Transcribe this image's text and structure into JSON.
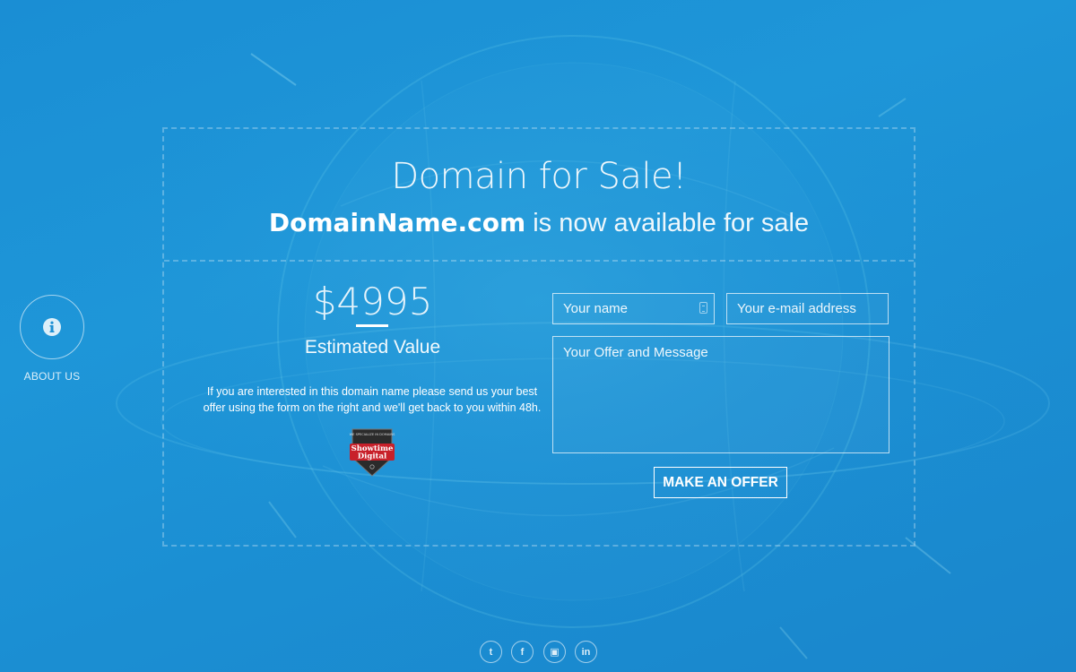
{
  "page": {
    "title": "Domain for Sale!",
    "domain": "DomainName.com",
    "subtitle_rest": " is now available for sale"
  },
  "offer": {
    "price": "$4995",
    "price_label": "Estimated Value",
    "description": "If you are interested in this domain name please send us your best offer using the form on the right and we'll get back to you within 48h.",
    "badge": {
      "top_text": "WE SPECIALIZE IN DOMAINS",
      "brand_line1": "Showtime",
      "brand_line2": "Digital"
    }
  },
  "form": {
    "name_placeholder": "Your name",
    "email_placeholder": "Your e-mail address",
    "message_placeholder": "Your Offer and Message",
    "submit_label": "MAKE AN OFFER"
  },
  "side_nav": {
    "about_label": "ABOUT US",
    "about_icon": "info-icon"
  },
  "social": [
    {
      "name": "twitter",
      "glyph": "t",
      "icon": "twitter-icon"
    },
    {
      "name": "facebook",
      "glyph": "f",
      "icon": "facebook-icon"
    },
    {
      "name": "youtube",
      "glyph": "▣",
      "icon": "youtube-icon"
    },
    {
      "name": "linkedin",
      "glyph": "in",
      "icon": "linkedin-icon"
    }
  ],
  "colors": {
    "background": "#1b8fd3",
    "accent": "#ffffff",
    "badge_red": "#c8202a"
  }
}
